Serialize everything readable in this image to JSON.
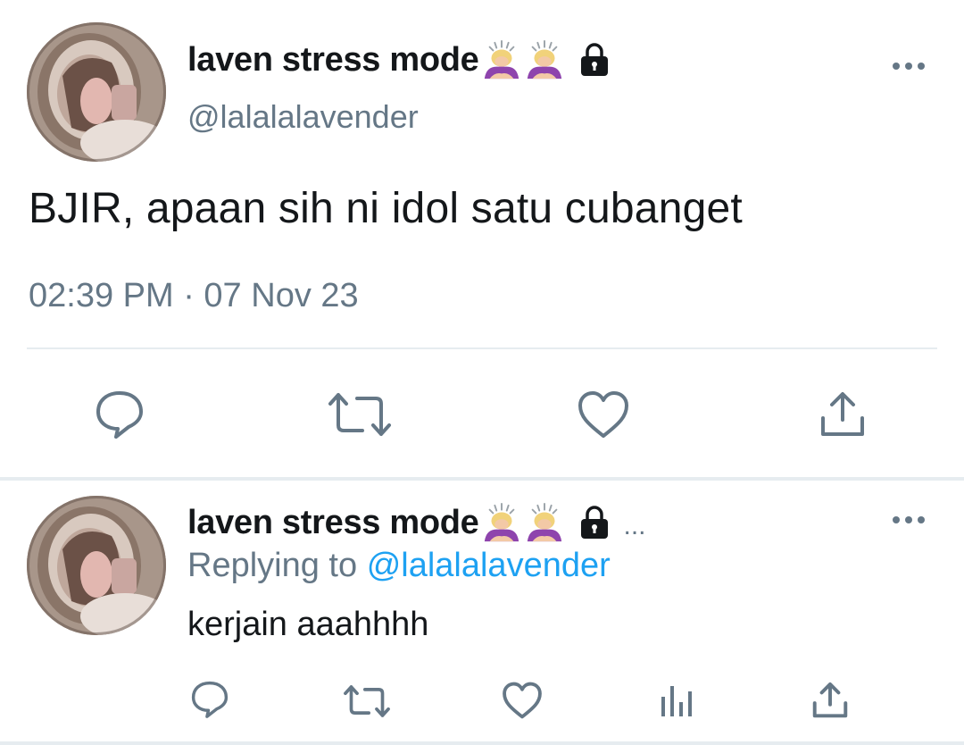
{
  "main_tweet": {
    "display_name": "laven stress mode",
    "name_emojis": [
      "woman-bowing-emoji",
      "woman-bowing-emoji"
    ],
    "protected": true,
    "handle": "@lalalalavender",
    "text": "BJIR, apaan sih ni idol satu cubanget",
    "timestamp": "02:39 PM · 07 Nov 23",
    "actions": [
      "reply",
      "retweet",
      "like",
      "share"
    ]
  },
  "reply": {
    "display_name": "laven stress mode",
    "name_emojis": [
      "woman-bowing-emoji",
      "woman-bowing-emoji"
    ],
    "protected": true,
    "truncation": "...",
    "replying_prefix": "Replying to",
    "replying_to": "@lalalalavender",
    "text": "kerjain aaahhhh",
    "actions": [
      "reply",
      "retweet",
      "like",
      "analytics",
      "share"
    ]
  },
  "colors": {
    "text_primary": "#14171a",
    "text_secondary": "#657786",
    "link": "#1da1f2",
    "icon": "#657786",
    "divider": "#e6ecf0"
  }
}
